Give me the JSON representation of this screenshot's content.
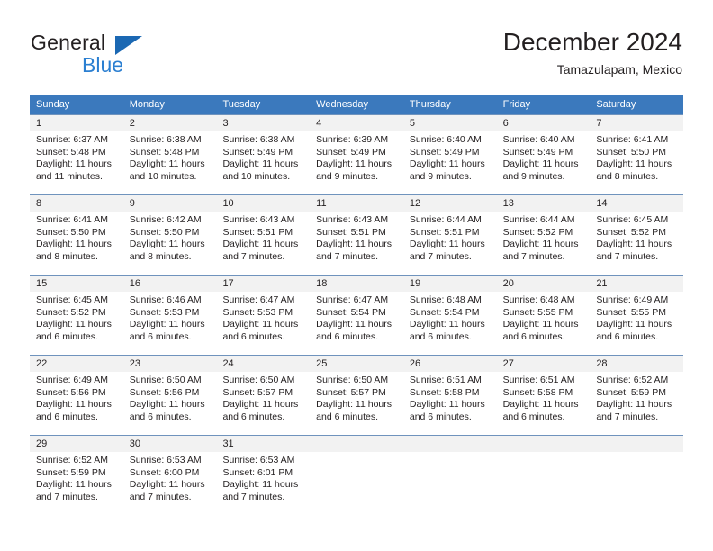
{
  "brand": {
    "name_top": "General",
    "name_bottom": "Blue",
    "accent_color": "#1b68b3",
    "blue_text_color": "#2b7fd1"
  },
  "header": {
    "title": "December 2024",
    "subtitle": "Tamazulapam, Mexico"
  },
  "theme": {
    "header_row_bg": "#3b79bd",
    "header_row_text": "#ffffff",
    "daynum_bg": "#f2f2f2",
    "row_divider": "#6f93bd",
    "body_text": "#231f20"
  },
  "weekday_headers": [
    "Sunday",
    "Monday",
    "Tuesday",
    "Wednesday",
    "Thursday",
    "Friday",
    "Saturday"
  ],
  "weeks": [
    [
      {
        "day": "1",
        "sunrise": "Sunrise: 6:37 AM",
        "sunset": "Sunset: 5:48 PM",
        "daylight_1": "Daylight: 11 hours",
        "daylight_2": "and 11 minutes."
      },
      {
        "day": "2",
        "sunrise": "Sunrise: 6:38 AM",
        "sunset": "Sunset: 5:48 PM",
        "daylight_1": "Daylight: 11 hours",
        "daylight_2": "and 10 minutes."
      },
      {
        "day": "3",
        "sunrise": "Sunrise: 6:38 AM",
        "sunset": "Sunset: 5:49 PM",
        "daylight_1": "Daylight: 11 hours",
        "daylight_2": "and 10 minutes."
      },
      {
        "day": "4",
        "sunrise": "Sunrise: 6:39 AM",
        "sunset": "Sunset: 5:49 PM",
        "daylight_1": "Daylight: 11 hours",
        "daylight_2": "and 9 minutes."
      },
      {
        "day": "5",
        "sunrise": "Sunrise: 6:40 AM",
        "sunset": "Sunset: 5:49 PM",
        "daylight_1": "Daylight: 11 hours",
        "daylight_2": "and 9 minutes."
      },
      {
        "day": "6",
        "sunrise": "Sunrise: 6:40 AM",
        "sunset": "Sunset: 5:49 PM",
        "daylight_1": "Daylight: 11 hours",
        "daylight_2": "and 9 minutes."
      },
      {
        "day": "7",
        "sunrise": "Sunrise: 6:41 AM",
        "sunset": "Sunset: 5:50 PM",
        "daylight_1": "Daylight: 11 hours",
        "daylight_2": "and 8 minutes."
      }
    ],
    [
      {
        "day": "8",
        "sunrise": "Sunrise: 6:41 AM",
        "sunset": "Sunset: 5:50 PM",
        "daylight_1": "Daylight: 11 hours",
        "daylight_2": "and 8 minutes."
      },
      {
        "day": "9",
        "sunrise": "Sunrise: 6:42 AM",
        "sunset": "Sunset: 5:50 PM",
        "daylight_1": "Daylight: 11 hours",
        "daylight_2": "and 8 minutes."
      },
      {
        "day": "10",
        "sunrise": "Sunrise: 6:43 AM",
        "sunset": "Sunset: 5:51 PM",
        "daylight_1": "Daylight: 11 hours",
        "daylight_2": "and 7 minutes."
      },
      {
        "day": "11",
        "sunrise": "Sunrise: 6:43 AM",
        "sunset": "Sunset: 5:51 PM",
        "daylight_1": "Daylight: 11 hours",
        "daylight_2": "and 7 minutes."
      },
      {
        "day": "12",
        "sunrise": "Sunrise: 6:44 AM",
        "sunset": "Sunset: 5:51 PM",
        "daylight_1": "Daylight: 11 hours",
        "daylight_2": "and 7 minutes."
      },
      {
        "day": "13",
        "sunrise": "Sunrise: 6:44 AM",
        "sunset": "Sunset: 5:52 PM",
        "daylight_1": "Daylight: 11 hours",
        "daylight_2": "and 7 minutes."
      },
      {
        "day": "14",
        "sunrise": "Sunrise: 6:45 AM",
        "sunset": "Sunset: 5:52 PM",
        "daylight_1": "Daylight: 11 hours",
        "daylight_2": "and 7 minutes."
      }
    ],
    [
      {
        "day": "15",
        "sunrise": "Sunrise: 6:45 AM",
        "sunset": "Sunset: 5:52 PM",
        "daylight_1": "Daylight: 11 hours",
        "daylight_2": "and 6 minutes."
      },
      {
        "day": "16",
        "sunrise": "Sunrise: 6:46 AM",
        "sunset": "Sunset: 5:53 PM",
        "daylight_1": "Daylight: 11 hours",
        "daylight_2": "and 6 minutes."
      },
      {
        "day": "17",
        "sunrise": "Sunrise: 6:47 AM",
        "sunset": "Sunset: 5:53 PM",
        "daylight_1": "Daylight: 11 hours",
        "daylight_2": "and 6 minutes."
      },
      {
        "day": "18",
        "sunrise": "Sunrise: 6:47 AM",
        "sunset": "Sunset: 5:54 PM",
        "daylight_1": "Daylight: 11 hours",
        "daylight_2": "and 6 minutes."
      },
      {
        "day": "19",
        "sunrise": "Sunrise: 6:48 AM",
        "sunset": "Sunset: 5:54 PM",
        "daylight_1": "Daylight: 11 hours",
        "daylight_2": "and 6 minutes."
      },
      {
        "day": "20",
        "sunrise": "Sunrise: 6:48 AM",
        "sunset": "Sunset: 5:55 PM",
        "daylight_1": "Daylight: 11 hours",
        "daylight_2": "and 6 minutes."
      },
      {
        "day": "21",
        "sunrise": "Sunrise: 6:49 AM",
        "sunset": "Sunset: 5:55 PM",
        "daylight_1": "Daylight: 11 hours",
        "daylight_2": "and 6 minutes."
      }
    ],
    [
      {
        "day": "22",
        "sunrise": "Sunrise: 6:49 AM",
        "sunset": "Sunset: 5:56 PM",
        "daylight_1": "Daylight: 11 hours",
        "daylight_2": "and 6 minutes."
      },
      {
        "day": "23",
        "sunrise": "Sunrise: 6:50 AM",
        "sunset": "Sunset: 5:56 PM",
        "daylight_1": "Daylight: 11 hours",
        "daylight_2": "and 6 minutes."
      },
      {
        "day": "24",
        "sunrise": "Sunrise: 6:50 AM",
        "sunset": "Sunset: 5:57 PM",
        "daylight_1": "Daylight: 11 hours",
        "daylight_2": "and 6 minutes."
      },
      {
        "day": "25",
        "sunrise": "Sunrise: 6:50 AM",
        "sunset": "Sunset: 5:57 PM",
        "daylight_1": "Daylight: 11 hours",
        "daylight_2": "and 6 minutes."
      },
      {
        "day": "26",
        "sunrise": "Sunrise: 6:51 AM",
        "sunset": "Sunset: 5:58 PM",
        "daylight_1": "Daylight: 11 hours",
        "daylight_2": "and 6 minutes."
      },
      {
        "day": "27",
        "sunrise": "Sunrise: 6:51 AM",
        "sunset": "Sunset: 5:58 PM",
        "daylight_1": "Daylight: 11 hours",
        "daylight_2": "and 6 minutes."
      },
      {
        "day": "28",
        "sunrise": "Sunrise: 6:52 AM",
        "sunset": "Sunset: 5:59 PM",
        "daylight_1": "Daylight: 11 hours",
        "daylight_2": "and 7 minutes."
      }
    ],
    [
      {
        "day": "29",
        "sunrise": "Sunrise: 6:52 AM",
        "sunset": "Sunset: 5:59 PM",
        "daylight_1": "Daylight: 11 hours",
        "daylight_2": "and 7 minutes."
      },
      {
        "day": "30",
        "sunrise": "Sunrise: 6:53 AM",
        "sunset": "Sunset: 6:00 PM",
        "daylight_1": "Daylight: 11 hours",
        "daylight_2": "and 7 minutes."
      },
      {
        "day": "31",
        "sunrise": "Sunrise: 6:53 AM",
        "sunset": "Sunset: 6:01 PM",
        "daylight_1": "Daylight: 11 hours",
        "daylight_2": "and 7 minutes."
      },
      {
        "day": "",
        "sunrise": "",
        "sunset": "",
        "daylight_1": "",
        "daylight_2": ""
      },
      {
        "day": "",
        "sunrise": "",
        "sunset": "",
        "daylight_1": "",
        "daylight_2": ""
      },
      {
        "day": "",
        "sunrise": "",
        "sunset": "",
        "daylight_1": "",
        "daylight_2": ""
      },
      {
        "day": "",
        "sunrise": "",
        "sunset": "",
        "daylight_1": "",
        "daylight_2": ""
      }
    ]
  ]
}
